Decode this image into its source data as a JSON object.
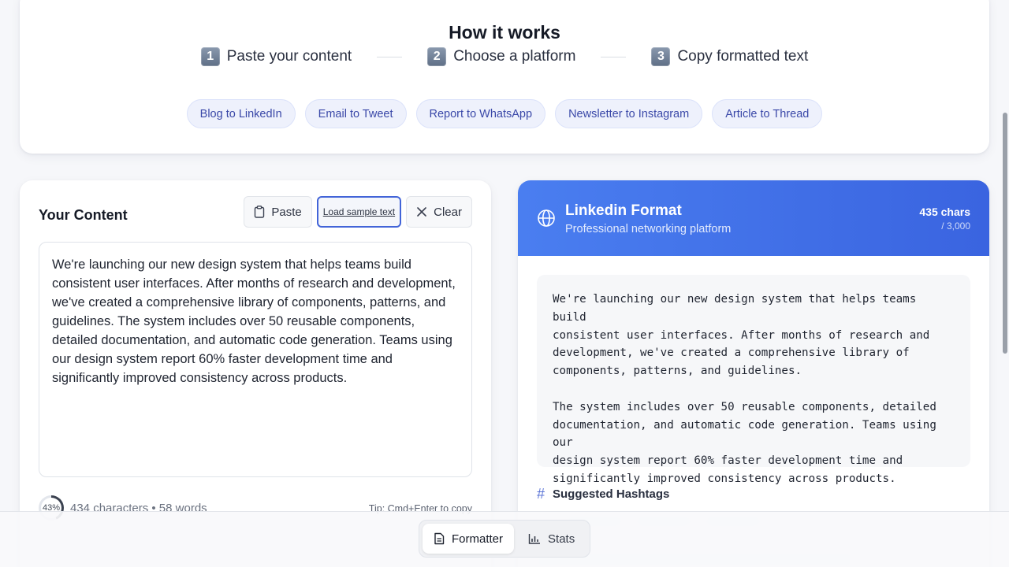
{
  "how_it_works": {
    "title": "How it works",
    "steps": [
      {
        "num": "1",
        "label": "Paste your content"
      },
      {
        "num": "2",
        "label": "Choose a platform"
      },
      {
        "num": "3",
        "label": "Copy formatted text"
      }
    ],
    "examples": [
      "Blog to LinkedIn",
      "Email to Tweet",
      "Report to WhatsApp",
      "Newsletter to Instagram",
      "Article to Thread"
    ]
  },
  "input": {
    "title": "Your Content",
    "paste_label": "Paste",
    "sample_label": "Load sample text",
    "clear_label": "Clear",
    "text": "We're launching our new design system that helps teams build consistent user interfaces. After months of research and development, we've created a comprehensive library of components, patterns, and guidelines. The system includes over 50 reusable components, detailed documentation, and automatic code generation. Teams using our design system report 60% faster development time and significantly improved consistency across products.",
    "progress_percent": 43,
    "progress_label": "43%",
    "counts": "434 characters • 58 words",
    "tip": "Tip: Cmd+Enter to copy"
  },
  "output": {
    "title": "Linkedin Format",
    "subtitle": "Professional networking platform",
    "char_count": "435 chars",
    "char_limit": "/ 3,000",
    "text": "We're launching our new design system that helps teams build\nconsistent user interfaces. After months of research and\ndevelopment, we've created a comprehensive library of\ncomponents, patterns, and guidelines.\n\nThe system includes over 50 reusable components, detailed\ndocumentation, and automatic code generation. Teams using our\ndesign system report 60% faster development time and\nsignificantly improved consistency across products.",
    "hashtags_label": "Suggested Hashtags"
  },
  "bottom_tabs": [
    {
      "label": "Formatter",
      "icon": "document-icon",
      "active": true
    },
    {
      "label": "Stats",
      "icon": "bar-chart-icon",
      "active": false
    }
  ],
  "colors": {
    "accent": "#3a64e0",
    "chip_bg": "#eef1fc",
    "chip_text": "#3a48a8"
  }
}
